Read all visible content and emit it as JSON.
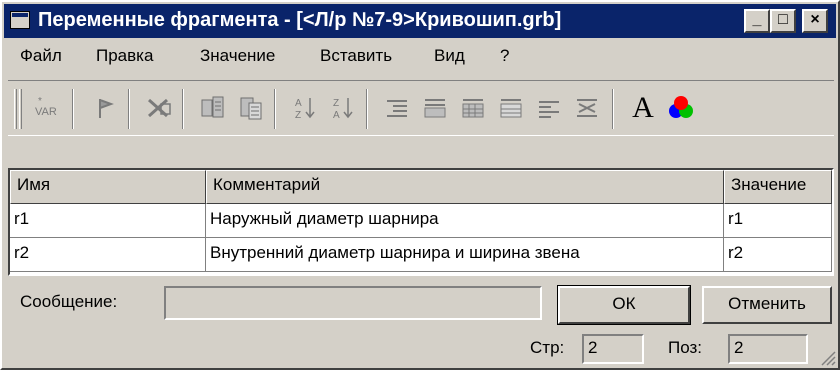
{
  "window": {
    "title": "Переменные фрагмента - [<Л/р №7-9>Кривошип.grb]",
    "minimize": "_",
    "maximize": "□",
    "close": "×"
  },
  "menu": [
    "Файл",
    "Правка",
    "Значение",
    "Вставить",
    "Вид",
    "?"
  ],
  "toolbar": {
    "icons": [
      "variable-icon",
      "flag-icon",
      "delete-icon",
      "copy-icon",
      "paste-icon",
      "sort-az-icon",
      "sort-za-icon",
      "list-icon-1",
      "list-icon-2",
      "list-icon-3",
      "list-icon-4",
      "list-icon-5",
      "list-icon-6",
      "font-icon",
      "color-icon"
    ],
    "font_glyph": "A",
    "var_label": "VAR"
  },
  "table": {
    "columns": [
      "Имя",
      "Комментарий",
      "Значение"
    ],
    "rows": [
      {
        "name": "r1",
        "comment": "Наружный диаметр шарнира",
        "value": "r1"
      },
      {
        "name": "r2",
        "comment": "Внутренний диаметр шарнира и ширина звена",
        "value": "r2"
      }
    ]
  },
  "footer": {
    "message_label": "Сообщение:",
    "message_value": "",
    "ok_label": "ОК",
    "cancel_label": "Отменить",
    "row_label": "Стр:",
    "row_value": "2",
    "col_label": "Поз:",
    "col_value": "2"
  },
  "colors": {
    "titlebar": "#0a246a",
    "face": "#d4d0c8"
  }
}
